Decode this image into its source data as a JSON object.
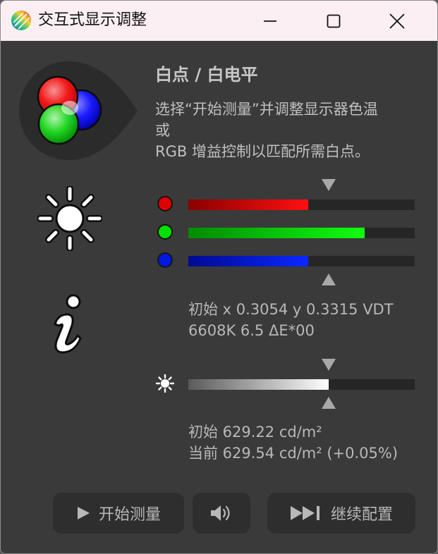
{
  "window": {
    "title": "交互式显示调整"
  },
  "colors": {
    "red": "#e00000",
    "green": "#00e000",
    "blue": "#0018e0"
  },
  "section": {
    "heading": "白点 / 白电平",
    "description": [
      "选择“开始测量”并调整显示器色温",
      "或",
      "RGB 增益控制以匹配所需白点。"
    ]
  },
  "rgb_gains": {
    "red": 0.53,
    "green": 0.78,
    "blue": 0.53
  },
  "luminance_level": 0.62,
  "white_point_readout": {
    "line1": "初始 x 0.3054 y 0.3315 VDT",
    "line2": "6608K 6.5 ΔE*00"
  },
  "luminance_readout": {
    "initial": "初始 629.22 cd/m²",
    "current": "当前 629.54 cd/m² (+0.05%)"
  },
  "buttons": {
    "start": "开始测量",
    "continue": "继续配置"
  },
  "icons": [
    "app-icon",
    "minimize-icon",
    "maximize-icon",
    "close-icon",
    "rgb-circles-icon",
    "brightness-icon",
    "info-icon",
    "play-icon",
    "speaker-icon",
    "skip-forward-icon"
  ]
}
